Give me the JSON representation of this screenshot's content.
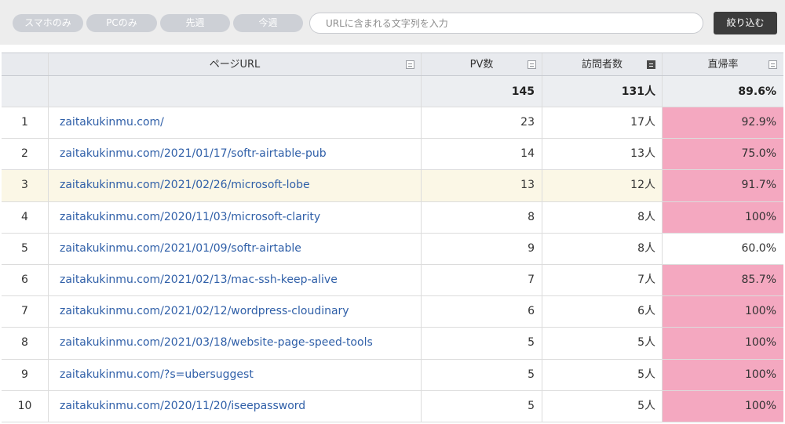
{
  "filters": [
    "スマホのみ",
    "PCのみ",
    "先週",
    "今週"
  ],
  "search": {
    "placeholder": "URLに含まれる文字列を入力",
    "value": ""
  },
  "submit_label": "絞り込む",
  "columns": {
    "url": "ページURL",
    "pv": "PV数",
    "visitors": "訪問者数",
    "bounce": "直帰率"
  },
  "totals": {
    "pv": "145",
    "visitors": "131人",
    "bounce": "89.6%"
  },
  "highlight_color": "#f4a8c0",
  "link_color": "#2f5fa8",
  "rows": [
    {
      "no": "1",
      "url": "zaitakukinmu.com/",
      "pv": "23",
      "visitors": "17人",
      "bounce": "92.9%",
      "hl": true
    },
    {
      "no": "2",
      "url": "zaitakukinmu.com/2021/01/17/softr-airtable-pub",
      "pv": "14",
      "visitors": "13人",
      "bounce": "75.0%",
      "hl": true
    },
    {
      "no": "3",
      "url": "zaitakukinmu.com/2021/02/26/microsoft-lobe",
      "pv": "13",
      "visitors": "12人",
      "bounce": "91.7%",
      "hl": true
    },
    {
      "no": "4",
      "url": "zaitakukinmu.com/2020/11/03/microsoft-clarity",
      "pv": "8",
      "visitors": "8人",
      "bounce": "100%",
      "hl": true
    },
    {
      "no": "5",
      "url": "zaitakukinmu.com/2021/01/09/softr-airtable",
      "pv": "9",
      "visitors": "8人",
      "bounce": "60.0%",
      "hl": false
    },
    {
      "no": "6",
      "url": "zaitakukinmu.com/2021/02/13/mac-ssh-keep-alive",
      "pv": "7",
      "visitors": "7人",
      "bounce": "85.7%",
      "hl": true
    },
    {
      "no": "7",
      "url": "zaitakukinmu.com/2021/02/12/wordpress-cloudinary",
      "pv": "6",
      "visitors": "6人",
      "bounce": "100%",
      "hl": true
    },
    {
      "no": "8",
      "url": "zaitakukinmu.com/2021/03/18/website-page-speed-tools",
      "pv": "5",
      "visitors": "5人",
      "bounce": "100%",
      "hl": true
    },
    {
      "no": "9",
      "url": "zaitakukinmu.com/?s=ubersuggest",
      "pv": "5",
      "visitors": "5人",
      "bounce": "100%",
      "hl": true
    },
    {
      "no": "10",
      "url": "zaitakukinmu.com/2020/11/20/iseepassword",
      "pv": "5",
      "visitors": "5人",
      "bounce": "100%",
      "hl": true
    }
  ]
}
